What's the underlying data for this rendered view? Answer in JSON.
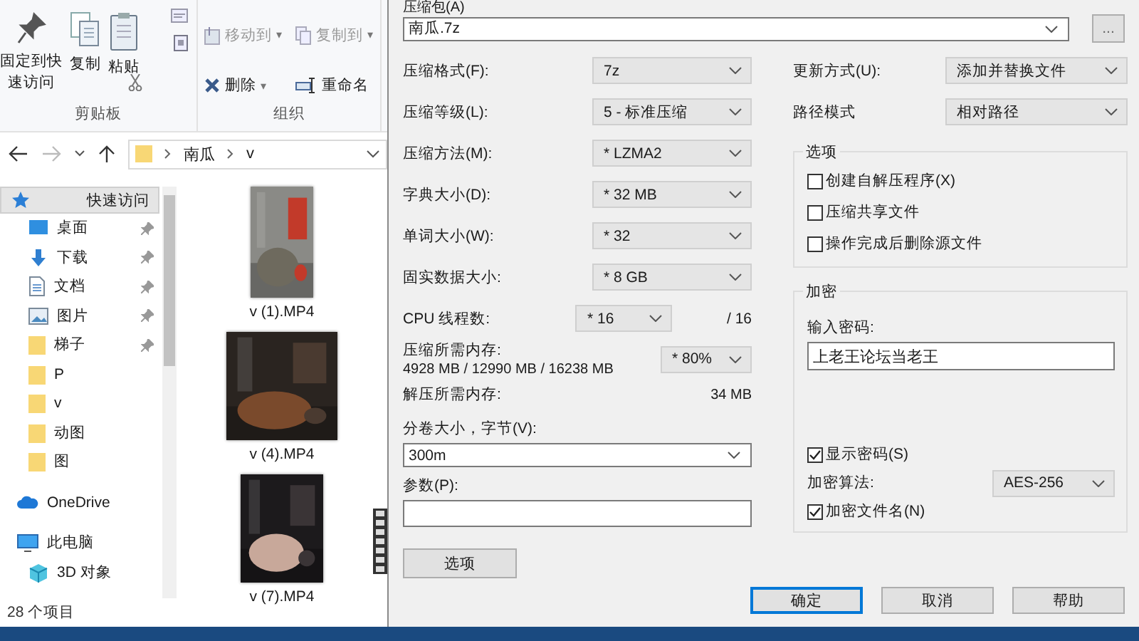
{
  "ribbon": {
    "groups": [
      {
        "label": "剪贴板",
        "items": [
          {
            "label": "固定到快速访问",
            "kind": "large"
          },
          {
            "label": "复制",
            "kind": "large"
          },
          {
            "label": "粘贴",
            "kind": "large"
          },
          {
            "kind": "tiny"
          },
          {
            "kind": "tiny"
          },
          {
            "kind": "tiny"
          }
        ]
      },
      {
        "label": "组织",
        "items": [
          {
            "label": "移动到",
            "kind": "small",
            "caret": "▾",
            "disabled": true
          },
          {
            "label": "复制到",
            "kind": "small",
            "caret": "▾",
            "disabled": true
          },
          {
            "label": "删除",
            "kind": "small",
            "caret": "▾",
            "disabled": false
          },
          {
            "label": "重命名",
            "kind": "small",
            "disabled": false
          }
        ]
      }
    ]
  },
  "address": {
    "path": [
      "南瓜",
      "v"
    ]
  },
  "nav": [
    {
      "label": "快速访问",
      "selected": true,
      "children": [
        {
          "label": "桌面",
          "selected": false,
          "pinned": true
        },
        {
          "label": "下载",
          "selected": false,
          "pinned": true
        },
        {
          "label": "文档",
          "selected": false,
          "pinned": true
        },
        {
          "label": "图片",
          "selected": false,
          "pinned": true
        },
        {
          "label": "梯子",
          "selected": false,
          "pinned": true
        },
        {
          "label": "P",
          "selected": false,
          "pinned": false
        },
        {
          "label": "v",
          "selected": false,
          "pinned": false
        },
        {
          "label": "动图",
          "selected": false,
          "pinned": false
        },
        {
          "label": "图",
          "selected": false,
          "pinned": false
        }
      ]
    },
    {
      "label": "OneDrive",
      "selected": false
    },
    {
      "label": "此电脑",
      "selected": false,
      "children": [
        {
          "label": "3D 对象",
          "selected": false,
          "pinned": false
        }
      ]
    }
  ],
  "files": [
    {
      "name": "v (1).MP4",
      "kind": "picture"
    },
    {
      "name": "v (4).MP4",
      "kind": "picture"
    },
    {
      "name": "v (7).MP4",
      "kind": "picture"
    }
  ],
  "status_bar": "28 个项目",
  "dialog": {
    "archive": {
      "label": "压缩包(A)",
      "value": "南瓜.7z",
      "browse": "..."
    },
    "settings": [
      {
        "label": "压缩格式(F):",
        "value": "7z"
      },
      {
        "label": "压缩等级(L):",
        "value": "5 - 标准压缩"
      },
      {
        "label": "压缩方法(M):",
        "value": "* LZMA2"
      },
      {
        "label": "字典大小(D):",
        "value": "* 32 MB"
      },
      {
        "label": "单词大小(W):",
        "value": "* 32"
      },
      {
        "label": "固实数据大小:",
        "value": "* 8 GB"
      }
    ],
    "cpu": {
      "label": "CPU 线程数:",
      "value": "* 16",
      "max": "/ 16"
    },
    "memory": {
      "label": "压缩所需内存:",
      "detail": "4928 MB / 12990 MB / 16238 MB",
      "value": "* 80%"
    },
    "decompress_memory": {
      "label": "解压所需内存:",
      "value": "34 MB"
    },
    "volume": {
      "label": "分卷大小，字节(V):",
      "value": "300m"
    },
    "parameters": {
      "label": "参数(P):"
    },
    "options_button": "选项",
    "update_mode": {
      "label": "更新方式(U):",
      "value": "添加并替换文件"
    },
    "path_mode": {
      "label": "路径模式",
      "value": "相对路径"
    },
    "options": {
      "title": "选项",
      "checkboxes": [
        {
          "label": "创建自解压程序(X)",
          "checked": false
        },
        {
          "label": "压缩共享文件",
          "checked": false
        },
        {
          "label": "操作完成后删除源文件",
          "checked": false
        }
      ]
    },
    "encryption": {
      "title": "加密",
      "password_label": "输入密码:",
      "password": "上老王论坛当老王",
      "show_password": {
        "label": "显示密码(S)",
        "checked": true
      },
      "method_label": "加密算法:",
      "method": "AES-256",
      "encrypt_names": {
        "label": "加密文件名(N)",
        "checked": true
      }
    },
    "buttons": [
      {
        "label": "确定",
        "focused": true
      },
      {
        "label": "取消",
        "focused": false
      },
      {
        "label": "帮助",
        "focused": false
      }
    ]
  }
}
